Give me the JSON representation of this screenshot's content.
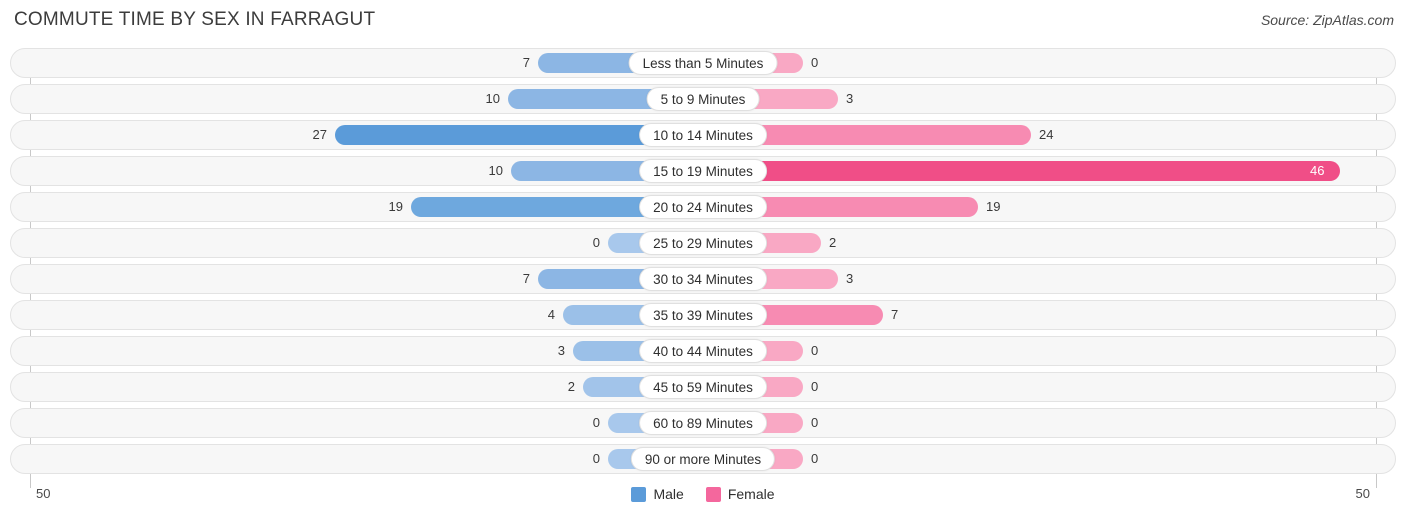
{
  "header": {
    "title": "COMMUTE TIME BY SEX IN FARRAGUT",
    "source": "Source: ZipAtlas.com"
  },
  "axis": {
    "left_label": "50",
    "right_label": "50",
    "max": 50
  },
  "legend": {
    "items": [
      {
        "label": "Male",
        "color": "#5B9BD9"
      },
      {
        "label": "Female",
        "color": "#F4679D"
      }
    ]
  },
  "colors": {
    "male_light": "#A8C8EC",
    "male_mid": "#8CB6E4",
    "male_dark": "#5B9BD9",
    "female_light": "#F9A8C4",
    "female_mid": "#F78BB2",
    "female_dark": "#F04E87",
    "track": "#f7f7f7",
    "track_border": "#e3e3e3"
  },
  "chart_data": {
    "type": "bar",
    "orientation": "horizontal-diverging",
    "title": "COMMUTE TIME BY SEX IN FARRAGUT",
    "xlabel": "",
    "ylabel": "",
    "xlim": [
      -50,
      50
    ],
    "grid": false,
    "legend_position": "bottom-center",
    "categories": [
      "Less than 5 Minutes",
      "5 to 9 Minutes",
      "10 to 14 Minutes",
      "15 to 19 Minutes",
      "20 to 24 Minutes",
      "25 to 29 Minutes",
      "30 to 34 Minutes",
      "35 to 39 Minutes",
      "40 to 44 Minutes",
      "45 to 59 Minutes",
      "60 to 89 Minutes",
      "90 or more Minutes"
    ],
    "series": [
      {
        "name": "Male",
        "values": [
          7,
          10,
          27,
          10,
          19,
          0,
          7,
          4,
          3,
          2,
          0,
          0
        ]
      },
      {
        "name": "Female",
        "values": [
          0,
          3,
          24,
          46,
          19,
          2,
          3,
          7,
          0,
          0,
          0,
          0
        ]
      }
    ]
  },
  "rows": [
    {
      "label": "Less than 5 Minutes",
      "male": 7,
      "female": 0,
      "male_text": "7",
      "female_text": "0",
      "male_color": "#8CB6E4",
      "female_color": "#F9A8C4",
      "male_w": 165,
      "female_w": 100,
      "female_inside": false,
      "male_inside": false
    },
    {
      "label": "5 to 9 Minutes",
      "male": 10,
      "female": 3,
      "male_text": "10",
      "female_text": "3",
      "male_color": "#8CB6E4",
      "female_color": "#F9A8C4",
      "male_w": 195,
      "female_w": 135,
      "female_inside": false,
      "male_inside": false
    },
    {
      "label": "10 to 14 Minutes",
      "male": 27,
      "female": 24,
      "male_text": "27",
      "female_text": "24",
      "male_color": "#5B9BD9",
      "female_color": "#F78BB2",
      "male_w": 368,
      "female_w": 328,
      "female_inside": false,
      "male_inside": false
    },
    {
      "label": "15 to 19 Minutes",
      "male": 10,
      "female": 46,
      "male_text": "10",
      "female_text": "46",
      "male_color": "#8CB6E4",
      "female_color": "#F04E87",
      "male_w": 192,
      "female_w": 637,
      "female_inside": true,
      "male_inside": false
    },
    {
      "label": "20 to 24 Minutes",
      "male": 19,
      "female": 19,
      "male_text": "19",
      "female_text": "19",
      "male_color": "#6EA8DE",
      "female_color": "#F78BB2",
      "male_w": 292,
      "female_w": 275,
      "female_inside": false,
      "male_inside": false
    },
    {
      "label": "25 to 29 Minutes",
      "male": 0,
      "female": 2,
      "male_text": "0",
      "female_text": "2",
      "male_color": "#A8C8EC",
      "female_color": "#F9A8C4",
      "male_w": 95,
      "female_w": 118,
      "female_inside": false,
      "male_inside": false
    },
    {
      "label": "30 to 34 Minutes",
      "male": 7,
      "female": 3,
      "male_text": "7",
      "female_text": "3",
      "male_color": "#8CB6E4",
      "female_color": "#F9A8C4",
      "male_w": 165,
      "female_w": 135,
      "female_inside": false,
      "male_inside": false
    },
    {
      "label": "35 to 39 Minutes",
      "male": 4,
      "female": 7,
      "male_text": "4",
      "female_text": "7",
      "male_color": "#9BC0E8",
      "female_color": "#F78BB2",
      "male_w": 140,
      "female_w": 180,
      "female_inside": false,
      "male_inside": false
    },
    {
      "label": "40 to 44 Minutes",
      "male": 3,
      "female": 0,
      "male_text": "3",
      "female_text": "0",
      "male_color": "#9BC0E8",
      "female_color": "#F9A8C4",
      "male_w": 130,
      "female_w": 100,
      "female_inside": false,
      "male_inside": false
    },
    {
      "label": "45 to 59 Minutes",
      "male": 2,
      "female": 0,
      "male_text": "2",
      "female_text": "0",
      "male_color": "#A2C4EA",
      "female_color": "#F9A8C4",
      "male_w": 120,
      "female_w": 100,
      "female_inside": false,
      "male_inside": false
    },
    {
      "label": "60 to 89 Minutes",
      "male": 0,
      "female": 0,
      "male_text": "0",
      "female_text": "0",
      "male_color": "#A8C8EC",
      "female_color": "#F9A8C4",
      "male_w": 95,
      "female_w": 100,
      "female_inside": false,
      "male_inside": false
    },
    {
      "label": "90 or more Minutes",
      "male": 0,
      "female": 0,
      "male_text": "0",
      "female_text": "0",
      "male_color": "#A8C8EC",
      "female_color": "#F9A8C4",
      "male_w": 95,
      "female_w": 100,
      "female_inside": false,
      "male_inside": false
    }
  ]
}
